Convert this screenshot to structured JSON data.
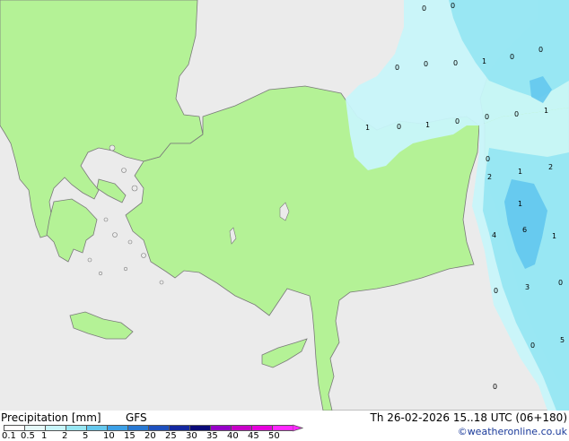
{
  "map": {
    "colors": {
      "sea": "#ebebeb",
      "land": "#b4f296",
      "coast": "#7a7a7a",
      "precip_light": "#c8f5fa",
      "precip_mid": "#96e6f2",
      "precip_high": "#64c8ee"
    },
    "value_labels": [
      {
        "text": "0"
      },
      {
        "text": "0"
      },
      {
        "text": "0"
      },
      {
        "text": "0"
      },
      {
        "text": "0"
      },
      {
        "text": "1"
      },
      {
        "text": "0"
      },
      {
        "text": "0"
      },
      {
        "text": "1"
      },
      {
        "text": "0"
      },
      {
        "text": "1"
      },
      {
        "text": "0"
      },
      {
        "text": "0"
      },
      {
        "text": "0"
      },
      {
        "text": "1"
      },
      {
        "text": "0"
      },
      {
        "text": "1"
      },
      {
        "text": "2"
      },
      {
        "text": "2"
      },
      {
        "text": "1"
      },
      {
        "text": "6"
      },
      {
        "text": "4"
      },
      {
        "text": "1"
      },
      {
        "text": "0"
      },
      {
        "text": "0"
      },
      {
        "text": "3"
      },
      {
        "text": "0"
      },
      {
        "text": "5"
      },
      {
        "text": "0"
      }
    ]
  },
  "footer": {
    "title": "Precipitation [mm]",
    "model": "GFS",
    "datetime": "Th 26-02-2026 15..18 UTC (06+180)",
    "credit": "©weatheronline.co.uk",
    "scale": [
      {
        "label": "0.1",
        "color": "#ffffff"
      },
      {
        "label": "0.5",
        "color": "#e6fafa"
      },
      {
        "label": "1",
        "color": "#c8f5fa"
      },
      {
        "label": "2",
        "color": "#96e6f2"
      },
      {
        "label": "5",
        "color": "#64c8ee"
      },
      {
        "label": "10",
        "color": "#3ca0e6"
      },
      {
        "label": "15",
        "color": "#2878d2"
      },
      {
        "label": "20",
        "color": "#1e50be"
      },
      {
        "label": "25",
        "color": "#1428a0"
      },
      {
        "label": "30",
        "color": "#0a0a78"
      },
      {
        "label": "35",
        "color": "#9600c8"
      },
      {
        "label": "40",
        "color": "#c800c8"
      },
      {
        "label": "45",
        "color": "#e600dc"
      },
      {
        "label": "50",
        "color": "#ff28ff"
      }
    ]
  }
}
